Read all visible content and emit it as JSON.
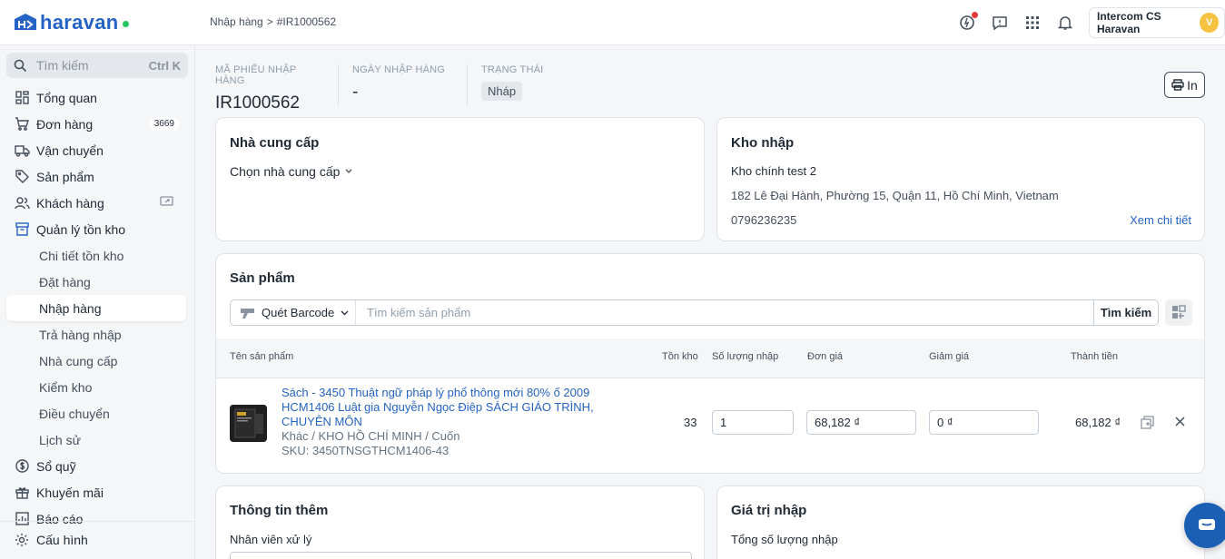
{
  "topbar": {
    "logo_text": "haravan",
    "breadcrumb_parent": "Nhập hàng",
    "breadcrumb_sep": ">",
    "breadcrumb_current": "#IR1000562",
    "user_name": "Intercom CS Haravan",
    "avatar_initial": "V"
  },
  "sidebar": {
    "search_placeholder": "Tìm kiếm",
    "search_shortcut": "Ctrl K",
    "items": [
      {
        "label": "Tổng quan",
        "icon": "dashboard-icon"
      },
      {
        "label": "Đơn hàng",
        "icon": "cart-icon",
        "badge": "3669"
      },
      {
        "label": "Vận chuyển",
        "icon": "truck-icon"
      },
      {
        "label": "Sản phẩm",
        "icon": "tag-icon"
      },
      {
        "label": "Khách hàng",
        "icon": "users-icon"
      },
      {
        "label": "Quản lý tồn kho",
        "icon": "inventory-icon"
      }
    ],
    "sub_items": [
      "Chi tiết tồn kho",
      "Đặt hàng",
      "Nhập hàng",
      "Trả hàng nhập",
      "Nhà cung cấp",
      "Kiểm kho",
      "Điều chuyển",
      "Lịch sử"
    ],
    "items_after": [
      {
        "label": "Sổ quỹ",
        "icon": "dollar-icon"
      },
      {
        "label": "Khuyến mãi",
        "icon": "gift-icon"
      },
      {
        "label": "Báo cáo",
        "icon": "report-icon"
      }
    ],
    "settings_label": "Cấu hình"
  },
  "meta": {
    "code_label": "MÃ PHIẾU NHẬP HÀNG",
    "code_value": "IR1000562",
    "date_label": "NGÀY NHẬP HÀNG",
    "date_value": "-",
    "status_label": "TRẠNG THÁI",
    "status_value": "Nháp",
    "print_label": "In"
  },
  "supplier": {
    "title": "Nhà cung cấp",
    "select_label": "Chọn nhà cung cấp"
  },
  "warehouse": {
    "title": "Kho nhập",
    "name": "Kho chính test 2",
    "address": "182 Lê Đại Hành, Phường 15, Quận 11, Hồ Chí Minh, Vietnam",
    "phone": "0796236235",
    "detail_link": "Xem chi tiết"
  },
  "products": {
    "title": "Sản phẩm",
    "barcode_label": "Quét Barcode",
    "search_placeholder": "Tìm kiếm sản phẩm",
    "search_button": "Tìm kiếm",
    "columns": [
      "Tên sản phẩm",
      "Tồn kho",
      "Số lượng nhập",
      "Đơn giá",
      "Giảm giá",
      "Thành tiền"
    ],
    "rows": [
      {
        "name_line1": "Sách - 3450 Thuật ngữ pháp lý phổ thông mới 80% ố 2009",
        "name_line2": "HCM1406 Luật gia Nguyễn Ngọc Điệp SÁCH GIÁO TRÌNH,",
        "name_line3": "CHUYÊN MÔN",
        "variant": "Khác / KHO HỒ CHÍ MINH / Cuốn",
        "sku": "SKU: 3450TNSGTHCM1406-43",
        "stock": "33",
        "qty": "1",
        "price": "68,182 ₫",
        "discount": "0 ₫",
        "total": "68,182 ₫"
      }
    ]
  },
  "extra": {
    "title": "Thông tin thêm",
    "staff_label": "Nhân viên xử lý"
  },
  "value": {
    "title": "Giá trị nhập",
    "total_qty_label": "Tổng số lượng nhập"
  }
}
